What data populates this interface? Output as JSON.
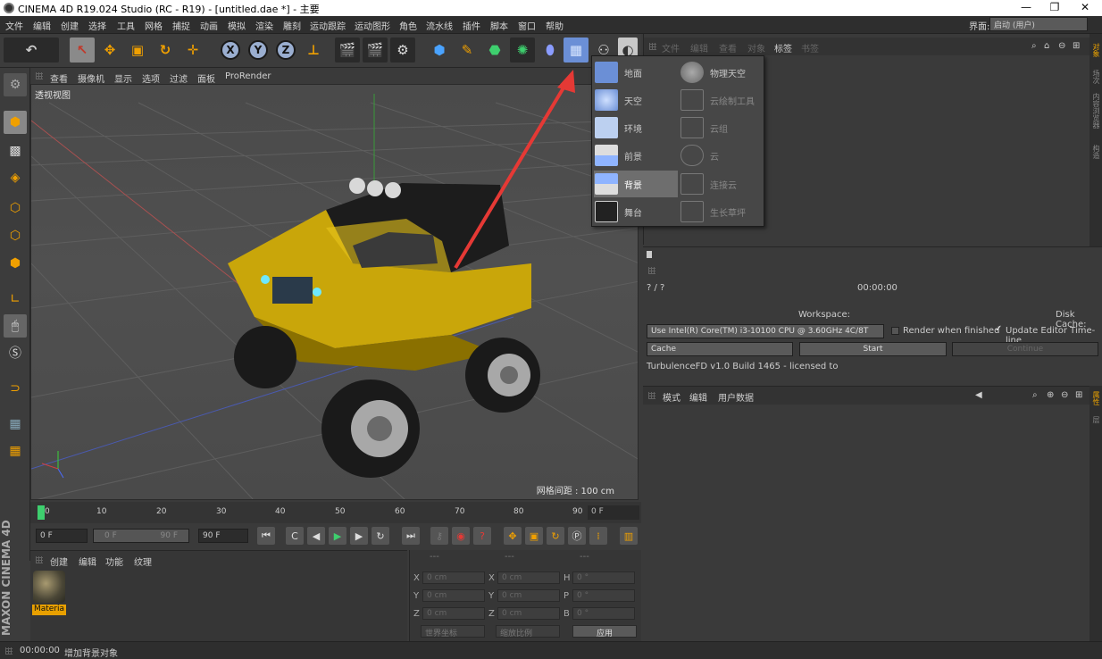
{
  "window": {
    "title": "CINEMA 4D R19.024 Studio (RC - R19) - [untitled.dae *] - 主要",
    "min": "—",
    "restore": "❐",
    "close": "✕"
  },
  "menu": [
    "文件",
    "编辑",
    "创建",
    "选择",
    "工具",
    "网格",
    "捕捉",
    "动画",
    "模拟",
    "渲染",
    "雕刻",
    "运动跟踪",
    "运动图形",
    "角色",
    "流水线",
    "插件",
    "脚本",
    "窗口",
    "帮助"
  ],
  "interface": {
    "label": "界面:",
    "value": "启动 (用户)"
  },
  "toolbar": {
    "axis_x": "X",
    "axis_y": "Y",
    "axis_z": "Z"
  },
  "viewport": {
    "menu": [
      "查看",
      "摄像机",
      "显示",
      "选项",
      "过滤",
      "面板",
      "ProRender"
    ],
    "label": "透视视图",
    "grid_label": "网格间距 : 100 cm"
  },
  "timeline": {
    "ticks": [
      "0",
      "10",
      "20",
      "30",
      "40",
      "50",
      "60",
      "70",
      "80",
      "90"
    ],
    "frame": "0 F"
  },
  "transport": {
    "start": "0 F",
    "range_start": "0 F",
    "range_end": "90 F",
    "end": "90 F"
  },
  "material": {
    "menu": [
      "创建",
      "编辑",
      "功能",
      "纹理"
    ],
    "name": "Materia"
  },
  "coords": {
    "rows": [
      {
        "a": "X",
        "av": "0 cm",
        "b": "X",
        "bv": "0 cm",
        "c": "H",
        "cv": "0 °"
      },
      {
        "a": "Y",
        "av": "0 cm",
        "b": "Y",
        "bv": "0 cm",
        "c": "P",
        "cv": "0 °"
      },
      {
        "a": "Z",
        "av": "0 cm",
        "b": "Z",
        "bv": "0 cm",
        "c": "B",
        "cv": "0 °"
      }
    ],
    "mode1": "世界坐标",
    "mode2": "缩放比例",
    "apply": "应用",
    "head": [
      "---",
      "---",
      "---"
    ]
  },
  "status": {
    "time": "00:00:00",
    "text": "增加背景对象"
  },
  "object_manager": {
    "menu": [
      "文件",
      "编辑",
      "查看",
      "对象",
      "标签",
      "书签"
    ]
  },
  "dropdown": {
    "left": [
      "地面",
      "天空",
      "环境",
      "前景",
      "背景",
      "舞台"
    ],
    "right": [
      "物理天空",
      "云绘制工具",
      "云组",
      "云",
      "连接云",
      "生长草坪"
    ],
    "highlighted": "背景"
  },
  "render_panel": {
    "frames": "? / ?",
    "time": "00:00:00",
    "workspace_label": "Workspace:",
    "disk_cache_label": "Disk Cache:",
    "cpu": "Use  Intel(R) Core(TM) i3-10100 CPU @ 3.60GHz 4C/8T",
    "render_when_finished": "Render when finished",
    "update_editor": "Update Editor Time-line",
    "cache": "Cache",
    "start": "Start",
    "continue": "Continue",
    "version": "TurbulenceFD v1.0 Build 1465 - licensed to"
  },
  "attributes": {
    "menu": [
      "模式",
      "编辑",
      "用户数据"
    ]
  },
  "side_tabs": [
    "对象",
    "场次",
    "内容浏览器",
    "构造",
    "属性",
    "层"
  ],
  "brand": "MAXON CINEMA 4D",
  "colors": {
    "accent": "#e8a000",
    "selected": "#8a8a8a",
    "arrow": "#e53935"
  }
}
